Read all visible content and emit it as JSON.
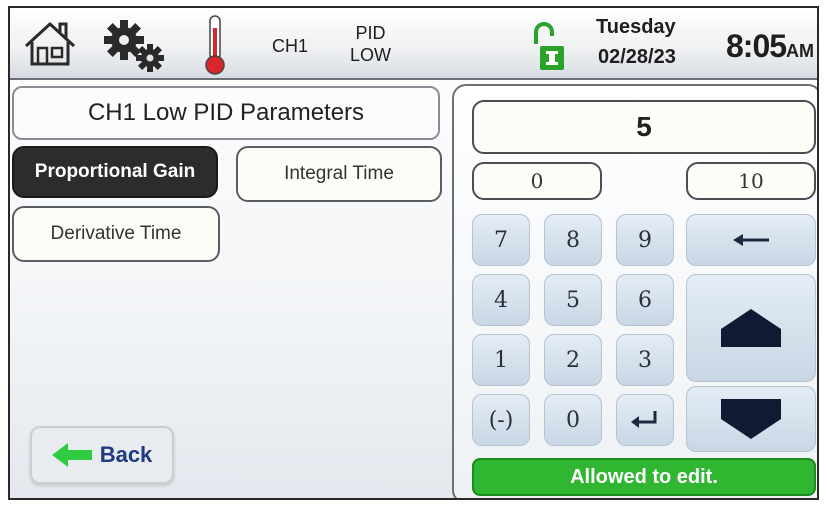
{
  "header": {
    "channel": "CH1",
    "pid_line1": "PID",
    "pid_line2": "LOW",
    "day": "Tuesday",
    "date": "02/28/23",
    "time": "8:05",
    "ampm": "AM"
  },
  "icons": {
    "home": "home-icon",
    "settings": "gear-icon",
    "temperature": "thermometer-icon",
    "lock": "unlock-icon"
  },
  "panel": {
    "title": "CH1 Low PID Parameters",
    "buttons": {
      "proportional": "Proportional Gain",
      "integral": "Integral Time",
      "derivative": "Derivative Time",
      "back": "Back"
    }
  },
  "keypad": {
    "value": "5",
    "min": "0",
    "max": "10",
    "keys": {
      "k7": "7",
      "k8": "8",
      "k9": "9",
      "k4": "4",
      "k5": "5",
      "k6": "6",
      "k1": "1",
      "k2": "2",
      "k3": "3",
      "neg": "(-)",
      "k0": "0"
    },
    "status": "Allowed to edit."
  },
  "colors": {
    "status_green": "#31b631",
    "selected_button": "#2c2c2c",
    "thermometer_red": "#d9262b",
    "lock_green": "#2aa32a",
    "back_arrow": "#2ecc40"
  }
}
